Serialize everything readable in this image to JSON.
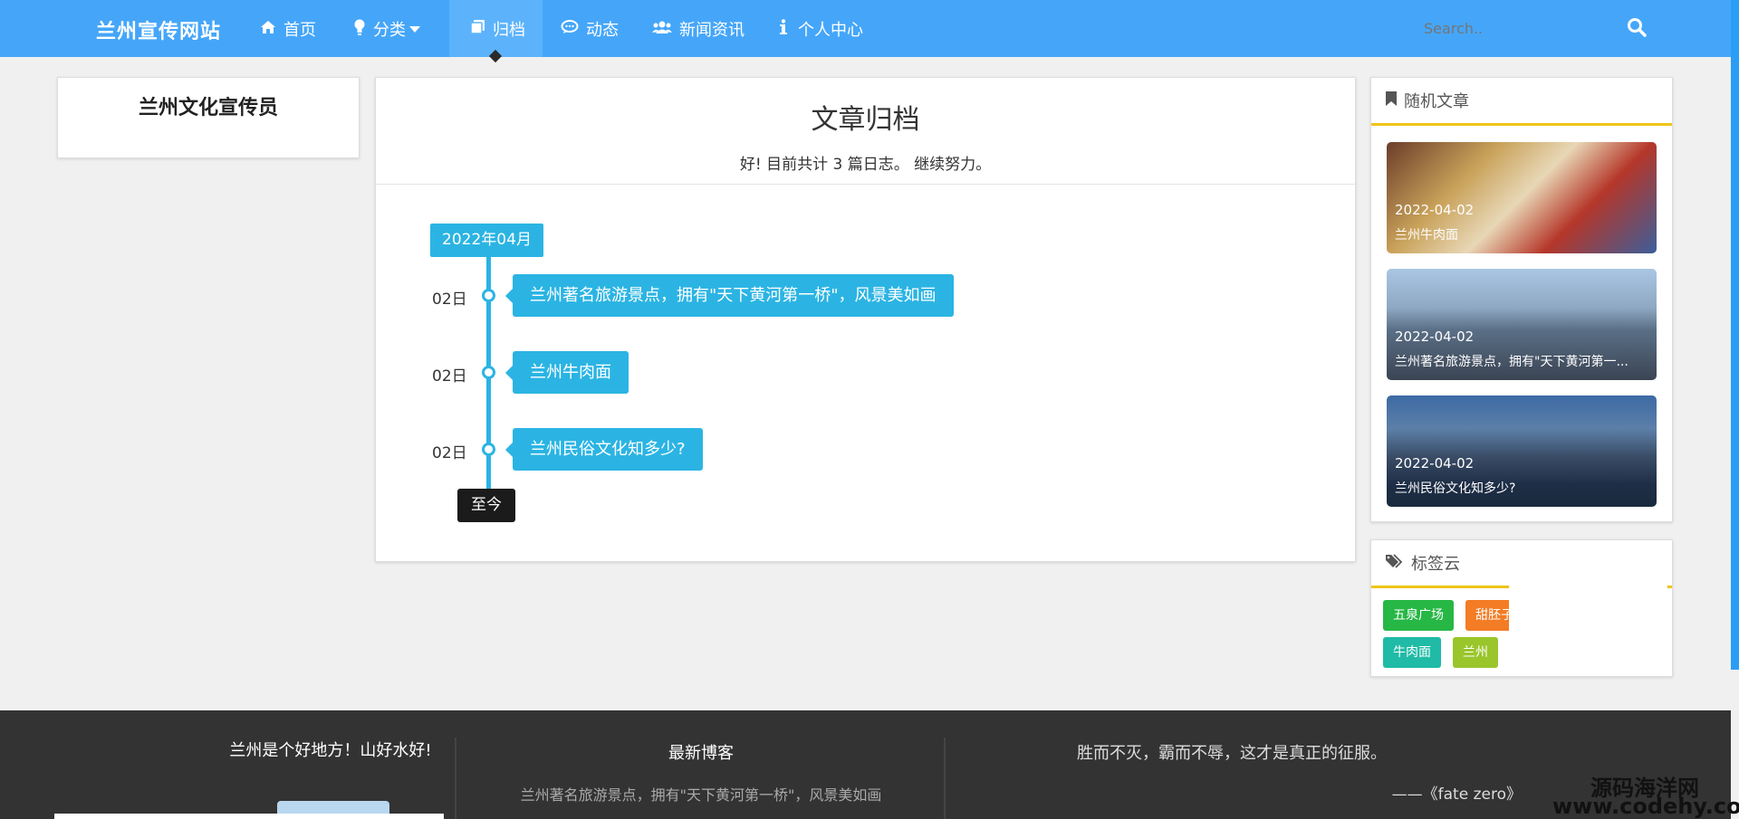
{
  "nav": {
    "brand": "兰州宣传网站",
    "items": [
      {
        "label": "首页",
        "icon": "home-icon"
      },
      {
        "label": "分类",
        "icon": "lightbulb-icon"
      },
      {
        "label": "归档",
        "icon": "copy-icon"
      },
      {
        "label": "动态",
        "icon": "comment-icon"
      },
      {
        "label": "新闻资讯",
        "icon": "users-icon"
      },
      {
        "label": "个人中心",
        "icon": "info-icon"
      }
    ],
    "search_placeholder": "Search..",
    "accent": "#45a6f9"
  },
  "profile": {
    "name": "兰州文化宣传员"
  },
  "archive": {
    "title": "文章归档",
    "summary": "好! 目前共计 3 篇日志。 继续努力。",
    "month": "2022年04月",
    "posts": [
      {
        "day": "02日",
        "title": "兰州著名旅游景点，拥有\"天下黄河第一桥\"，风景美如画"
      },
      {
        "day": "02日",
        "title": "兰州牛肉面"
      },
      {
        "day": "02日",
        "title": "兰州民俗文化知多少?"
      }
    ],
    "end_label": "至今"
  },
  "random": {
    "title": "随机文章",
    "items": [
      {
        "date": "2022-04-02",
        "title": "兰州牛肉面"
      },
      {
        "date": "2022-04-02",
        "title": "兰州著名旅游景点，拥有\"天下黄河第一..."
      },
      {
        "date": "2022-04-02",
        "title": "兰州民俗文化知多少?"
      }
    ]
  },
  "tagcloud": {
    "title": "标签云",
    "tags": [
      {
        "label": "五泉广场",
        "color": "#27b745"
      },
      {
        "label": "甜胚子",
        "color": "#f37c25"
      },
      {
        "label": "牛肉面",
        "color": "#1fbba6"
      },
      {
        "label": "兰州",
        "color": "#9ac52b"
      }
    ]
  },
  "footer": {
    "about": "兰州是个好地方！山好水好!",
    "latest_title": "最新博客",
    "latest_post": "兰州著名旅游景点，拥有\"天下黄河第一桥\"，风景美如画",
    "quote": "胜而不灭，霸而不辱，这才是真正的征服。",
    "quote_source": "——《fate zero》"
  },
  "watermark": {
    "name": "源码海洋网",
    "url": "www.codehy.com"
  }
}
